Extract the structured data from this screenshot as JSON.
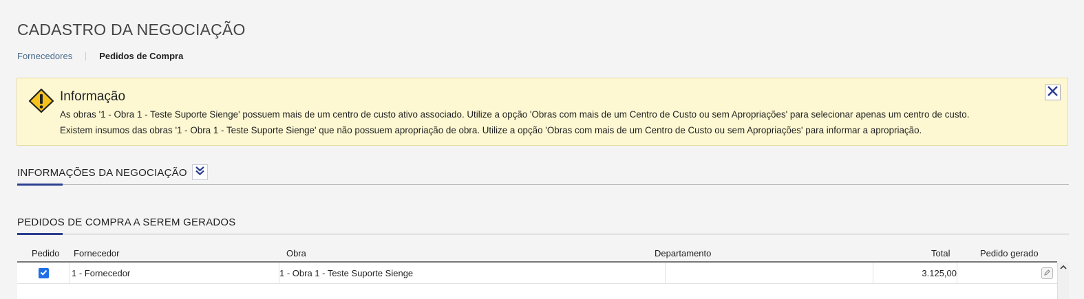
{
  "page": {
    "title": "CADASTRO DA NEGOCIAÇÃO"
  },
  "breadcrumb": {
    "link": "Fornecedores",
    "current": "Pedidos de Compra"
  },
  "alert": {
    "icon": "warning-icon",
    "title": "Informação",
    "messages": [
      "As obras '1 - Obra 1 - Teste Suporte Sienge' possuem mais de um centro de custo ativo associado. Utilize a opção 'Obras com mais de um Centro de Custo ou sem Apropriações' para selecionar apenas um centro de custo.",
      "Existem insumos das obras '1 - Obra 1 - Teste Suporte Sienge' que não possuem apropriação de obra. Utilize a opção 'Obras com mais de um Centro de Custo ou sem Apropriações' para informar a apropriação."
    ]
  },
  "sections": {
    "info": "INFORMAÇÕES DA NEGOCIAÇÃO",
    "orders": "PEDIDOS DE COMPRA A SEREM GERADOS"
  },
  "table": {
    "columns": [
      "Pedido",
      "Fornecedor",
      "Obra",
      "Departamento",
      "Total",
      "Pedido gerado"
    ],
    "rows": [
      {
        "pedido_checked": true,
        "fornecedor": "1 - Fornecedor",
        "obra": "1 - Obra 1 - Teste Suporte Sienge",
        "departamento": "",
        "total": "3.125,00",
        "pedido_gerado": ""
      }
    ]
  },
  "colors": {
    "accent": "#2c3e8f",
    "alert_bg": "#fdf8d2",
    "checkbox": "#1e6ee6",
    "link": "#4a6b8a"
  }
}
